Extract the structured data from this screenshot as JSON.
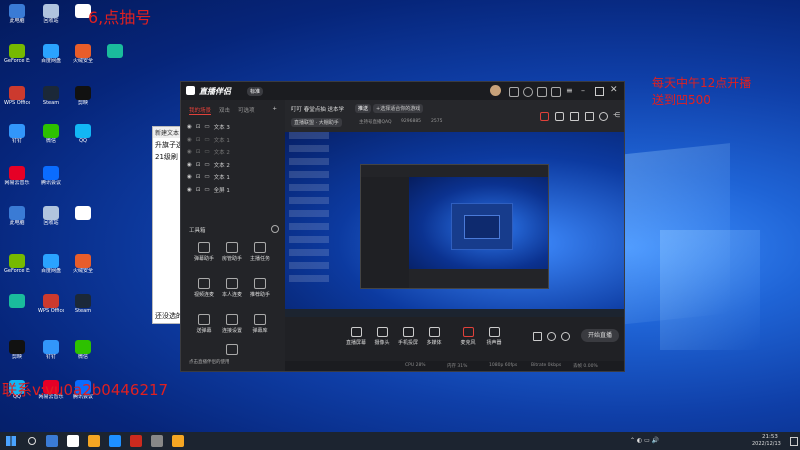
{
  "overlay": {
    "top_left": "6,点抽号",
    "top_right_line1": "每天中午12点开播",
    "top_right_line2": "送到凹500",
    "bottom_left": "联系v:vu0a2b0446217"
  },
  "desktop_icons": [
    {
      "label": "此电脑",
      "color": "#3a7bd5"
    },
    {
      "label": "回收站",
      "color": "#b0c4de"
    },
    {
      "label": "",
      "color": "#ffffff"
    },
    {
      "label": "GeForce Experience",
      "color": "#76b900"
    },
    {
      "label": "百度网盘",
      "color": "#2aa3ff"
    },
    {
      "label": "火绒安全",
      "color": "#e85d2a"
    },
    {
      "label": "",
      "color": "#1abc9c"
    },
    {
      "label": "WPS Office",
      "color": "#cc3a2e"
    },
    {
      "label": "Steam",
      "color": "#1b2838"
    },
    {
      "label": "剪映",
      "color": "#111111"
    },
    {
      "label": "钉钉",
      "color": "#3296fa"
    },
    {
      "label": "微信",
      "color": "#2dc100"
    },
    {
      "label": "QQ",
      "color": "#12b7f5"
    },
    {
      "label": "网易云音乐",
      "color": "#e60026"
    },
    {
      "label": "腾讯会议",
      "color": "#0a6cff"
    }
  ],
  "notepad": {
    "title": "新建文本",
    "line1": "升旗子选",
    "line2": "21级刷",
    "bottom": "还没选的"
  },
  "app": {
    "name": "直播伴侣",
    "badge": "标准",
    "tabs": [
      "我的场景",
      "双击",
      "可选项"
    ],
    "scenes": [
      {
        "label": "文本 3"
      },
      {
        "label": "文本 1"
      },
      {
        "label": "文本 2"
      },
      {
        "label": "文本 2"
      },
      {
        "label": "文本 1"
      },
      {
        "label": "全屏 1"
      }
    ],
    "tools_label": "工具箱",
    "tools": [
      {
        "label": "弹幕助手"
      },
      {
        "label": "房管助手"
      },
      {
        "label": "主播任务"
      },
      {
        "label": "视频连麦"
      },
      {
        "label": "本人连麦"
      },
      {
        "label": "推荐助手"
      },
      {
        "label": "送弹幕"
      },
      {
        "label": "连接设置"
      },
      {
        "label": "弹幕库"
      },
      {
        "label": "",
        "label2": ""
      }
    ],
    "bottom_note": "点击直播伴侣的使用",
    "stream_title": "叮叮 春堂点抽 送本学",
    "tag": "推送",
    "category_btn": "+选择适合你的游戏",
    "room_tag": "直播联盟 · 大棚助手",
    "room_id": "9296885",
    "room_label": "主持号直播QAQ",
    "viewers": "2575",
    "source_buttons": [
      {
        "label": "直播屏幕"
      },
      {
        "label": "摄像头"
      },
      {
        "label": "手机投屏"
      },
      {
        "label": "多媒体"
      },
      {
        "label": "麦克风"
      },
      {
        "label": "扬声器"
      }
    ],
    "start_button": "开始直播",
    "status_items": [
      "CPU 28%",
      "内存 31%",
      "1080p 60fps",
      "Bitrate 0kbps",
      "丢帧 0.00%"
    ]
  },
  "taskbar": {
    "time": "21:53",
    "date": "2022/12/13",
    "icons": [
      "#3a7bd5",
      "#fff",
      "#f5a623",
      "#1e90ff",
      "#cc2a1e",
      "#888",
      "#f5a623"
    ]
  }
}
